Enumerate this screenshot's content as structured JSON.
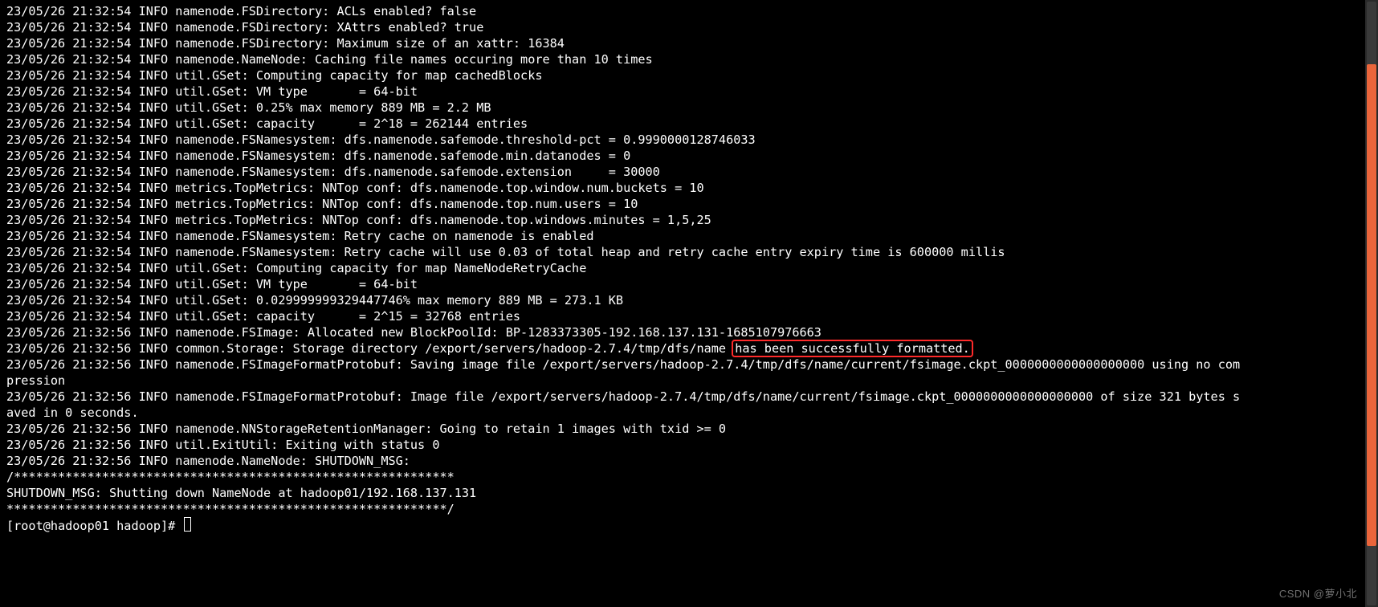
{
  "terminal": {
    "lines": [
      "23/05/26 21:32:54 INFO namenode.FSDirectory: ACLs enabled? false",
      "23/05/26 21:32:54 INFO namenode.FSDirectory: XAttrs enabled? true",
      "23/05/26 21:32:54 INFO namenode.FSDirectory: Maximum size of an xattr: 16384",
      "23/05/26 21:32:54 INFO namenode.NameNode: Caching file names occuring more than 10 times",
      "23/05/26 21:32:54 INFO util.GSet: Computing capacity for map cachedBlocks",
      "23/05/26 21:32:54 INFO util.GSet: VM type       = 64-bit",
      "23/05/26 21:32:54 INFO util.GSet: 0.25% max memory 889 MB = 2.2 MB",
      "23/05/26 21:32:54 INFO util.GSet: capacity      = 2^18 = 262144 entries",
      "23/05/26 21:32:54 INFO namenode.FSNamesystem: dfs.namenode.safemode.threshold-pct = 0.9990000128746033",
      "23/05/26 21:32:54 INFO namenode.FSNamesystem: dfs.namenode.safemode.min.datanodes = 0",
      "23/05/26 21:32:54 INFO namenode.FSNamesystem: dfs.namenode.safemode.extension     = 30000",
      "23/05/26 21:32:54 INFO metrics.TopMetrics: NNTop conf: dfs.namenode.top.window.num.buckets = 10",
      "23/05/26 21:32:54 INFO metrics.TopMetrics: NNTop conf: dfs.namenode.top.num.users = 10",
      "23/05/26 21:32:54 INFO metrics.TopMetrics: NNTop conf: dfs.namenode.top.windows.minutes = 1,5,25",
      "23/05/26 21:32:54 INFO namenode.FSNamesystem: Retry cache on namenode is enabled",
      "23/05/26 21:32:54 INFO namenode.FSNamesystem: Retry cache will use 0.03 of total heap and retry cache entry expiry time is 600000 millis",
      "23/05/26 21:32:54 INFO util.GSet: Computing capacity for map NameNodeRetryCache",
      "23/05/26 21:32:54 INFO util.GSet: VM type       = 64-bit",
      "23/05/26 21:32:54 INFO util.GSet: 0.029999999329447746% max memory 889 MB = 273.1 KB",
      "23/05/26 21:32:54 INFO util.GSet: capacity      = 2^15 = 32768 entries",
      "23/05/26 21:32:56 INFO namenode.FSImage: Allocated new BlockPoolId: BP-1283373305-192.168.137.131-1685107976663"
    ],
    "highlight_line": {
      "prefix": "23/05/26 21:32:56 INFO common.Storage: Storage directory /export/servers/hadoop-2.7.4/tmp/dfs/name ",
      "highlight": "has been successfully formatted."
    },
    "lines_after": [
      "23/05/26 21:32:56 INFO namenode.FSImageFormatProtobuf: Saving image file /export/servers/hadoop-2.7.4/tmp/dfs/name/current/fsimage.ckpt_0000000000000000000 using no compression",
      "23/05/26 21:32:56 INFO namenode.FSImageFormatProtobuf: Image file /export/servers/hadoop-2.7.4/tmp/dfs/name/current/fsimage.ckpt_0000000000000000000 of size 321 bytes saved in 0 seconds.",
      "23/05/26 21:32:56 INFO namenode.NNStorageRetentionManager: Going to retain 1 images with txid >= 0",
      "23/05/26 21:32:56 INFO util.ExitUtil: Exiting with status 0",
      "23/05/26 21:32:56 INFO namenode.NameNode: SHUTDOWN_MSG:",
      "/************************************************************",
      "SHUTDOWN_MSG: Shutting down NameNode at hadoop01/192.168.137.131",
      "************************************************************/"
    ],
    "prompt": "[root@hadoop01 hadoop]# "
  },
  "watermark": "CSDN @萝小北",
  "wrap_width_chars": 168
}
